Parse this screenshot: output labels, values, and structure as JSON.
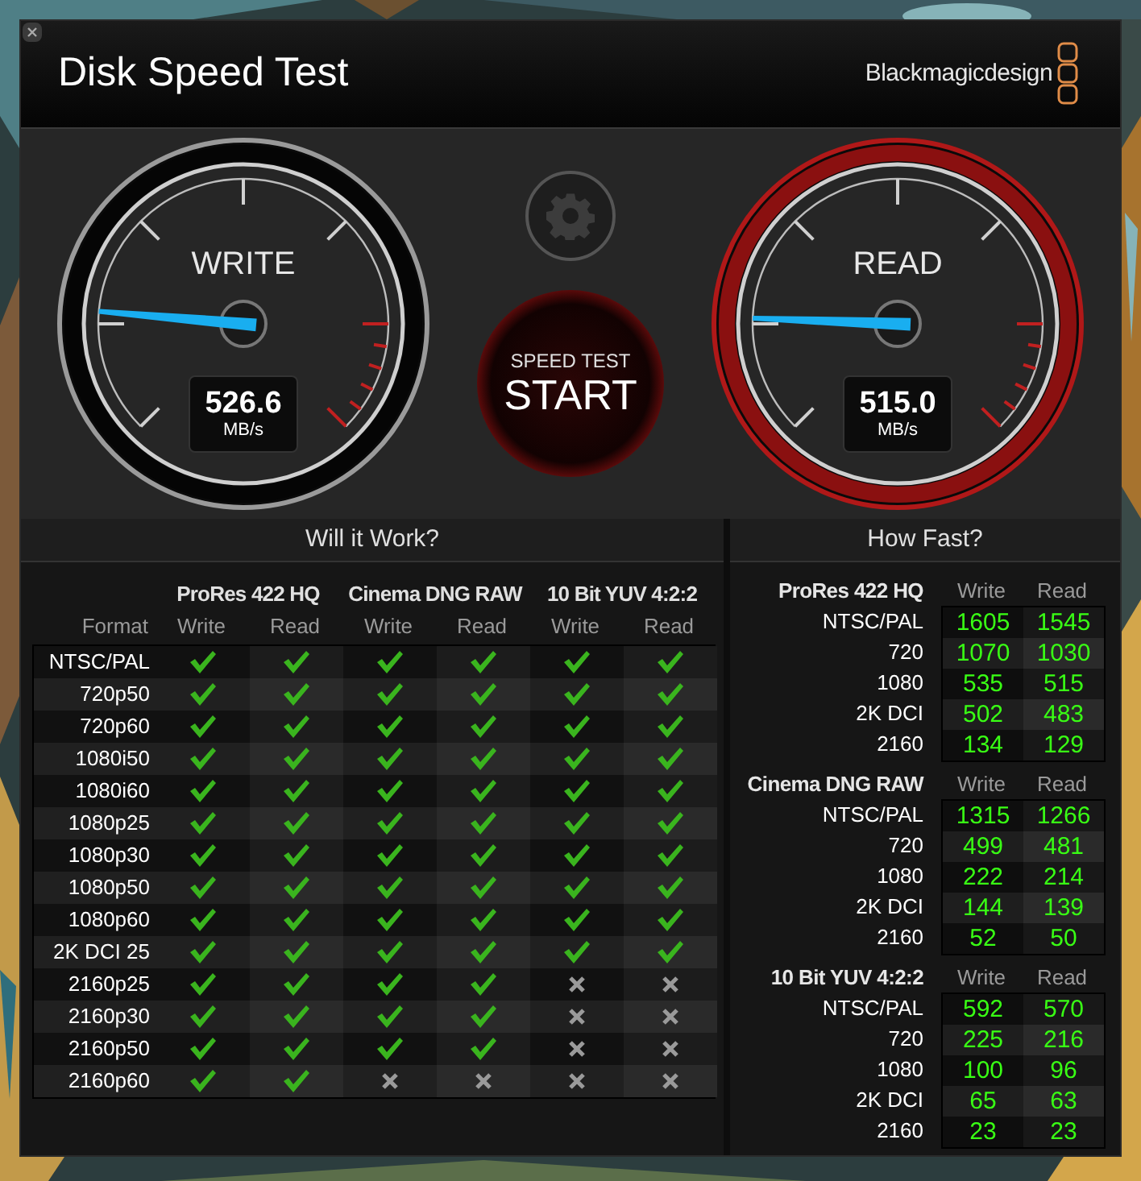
{
  "window": {
    "title": "Disk Speed Test",
    "brand": "Blackmagicdesign"
  },
  "gauges": [
    {
      "label": "WRITE",
      "reading": "526.6",
      "unit": "MB/s",
      "level": 0.185,
      "active": false
    },
    {
      "label": "READ",
      "reading": "515.0",
      "unit": "MB/s",
      "level": 0.175,
      "active": true
    }
  ],
  "start_button": {
    "caption": "SPEED TEST",
    "label": "START"
  },
  "will_it_work": {
    "title": "Will it Work?",
    "format_header": "Format",
    "groups": [
      "ProRes 422 HQ",
      "Cinema DNG RAW",
      "10 Bit YUV 4:2:2"
    ],
    "subheaders": [
      "Write",
      "Read",
      "Write",
      "Read",
      "Write",
      "Read"
    ],
    "rows": [
      {
        "format": "NTSC/PAL",
        "supported": [
          true,
          true,
          true,
          true,
          true,
          true
        ]
      },
      {
        "format": "720p50",
        "supported": [
          true,
          true,
          true,
          true,
          true,
          true
        ]
      },
      {
        "format": "720p60",
        "supported": [
          true,
          true,
          true,
          true,
          true,
          true
        ]
      },
      {
        "format": "1080i50",
        "supported": [
          true,
          true,
          true,
          true,
          true,
          true
        ]
      },
      {
        "format": "1080i60",
        "supported": [
          true,
          true,
          true,
          true,
          true,
          true
        ]
      },
      {
        "format": "1080p25",
        "supported": [
          true,
          true,
          true,
          true,
          true,
          true
        ]
      },
      {
        "format": "1080p30",
        "supported": [
          true,
          true,
          true,
          true,
          true,
          true
        ]
      },
      {
        "format": "1080p50",
        "supported": [
          true,
          true,
          true,
          true,
          true,
          true
        ]
      },
      {
        "format": "1080p60",
        "supported": [
          true,
          true,
          true,
          true,
          true,
          true
        ]
      },
      {
        "format": "2K DCI 25",
        "supported": [
          true,
          true,
          true,
          true,
          true,
          true
        ]
      },
      {
        "format": "2160p25",
        "supported": [
          true,
          true,
          true,
          true,
          false,
          false
        ]
      },
      {
        "format": "2160p30",
        "supported": [
          true,
          true,
          true,
          true,
          false,
          false
        ]
      },
      {
        "format": "2160p50",
        "supported": [
          true,
          true,
          true,
          true,
          false,
          false
        ]
      },
      {
        "format": "2160p60",
        "supported": [
          true,
          true,
          false,
          false,
          false,
          false
        ]
      }
    ]
  },
  "how_fast": {
    "title": "How Fast?",
    "sections": [
      {
        "codec": "ProRes 422 HQ",
        "write_header": "Write",
        "read_header": "Read",
        "rows": [
          {
            "format": "NTSC/PAL",
            "write": "1605",
            "read": "1545"
          },
          {
            "format": "720",
            "write": "1070",
            "read": "1030"
          },
          {
            "format": "1080",
            "write": "535",
            "read": "515"
          },
          {
            "format": "2K DCI",
            "write": "502",
            "read": "483"
          },
          {
            "format": "2160",
            "write": "134",
            "read": "129"
          }
        ]
      },
      {
        "codec": "Cinema DNG RAW",
        "write_header": "Write",
        "read_header": "Read",
        "rows": [
          {
            "format": "NTSC/PAL",
            "write": "1315",
            "read": "1266"
          },
          {
            "format": "720",
            "write": "499",
            "read": "481"
          },
          {
            "format": "1080",
            "write": "222",
            "read": "214"
          },
          {
            "format": "2K DCI",
            "write": "144",
            "read": "139"
          },
          {
            "format": "2160",
            "write": "52",
            "read": "50"
          }
        ]
      },
      {
        "codec": "10 Bit YUV 4:2:2",
        "write_header": "Write",
        "read_header": "Read",
        "rows": [
          {
            "format": "NTSC/PAL",
            "write": "592",
            "read": "570"
          },
          {
            "format": "720",
            "write": "225",
            "read": "216"
          },
          {
            "format": "1080",
            "write": "100",
            "read": "96"
          },
          {
            "format": "2K DCI",
            "write": "65",
            "read": "63"
          },
          {
            "format": "2160",
            "write": "23",
            "read": "23"
          }
        ]
      }
    ]
  }
}
